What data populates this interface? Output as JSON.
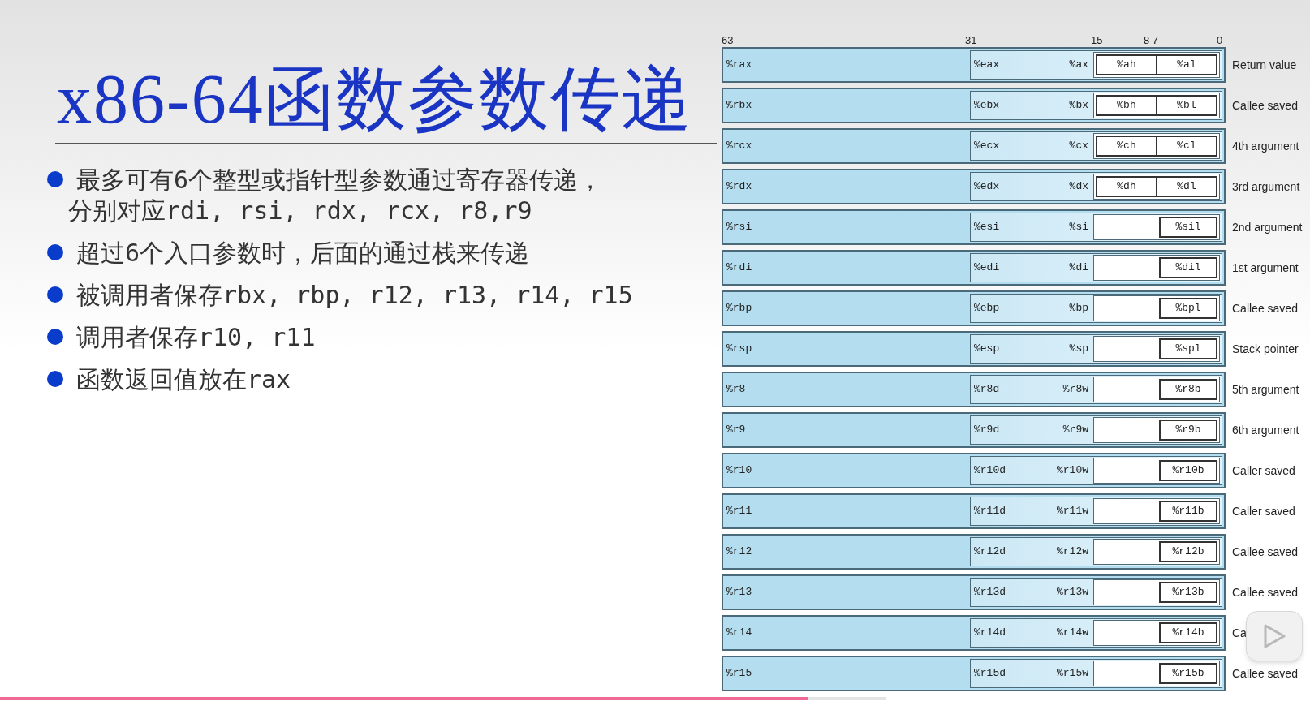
{
  "slide": {
    "title": "x86-64函数参数传递",
    "bullets": [
      {
        "lines": [
          "最多可有6个整型或指针型参数通过寄存器传递，",
          "分别对应rdi, rsi, rdx, rcx, r8,r9"
        ]
      },
      {
        "lines": [
          "超过6个入口参数时，后面的通过栈来传递"
        ]
      },
      {
        "lines": [
          "被调用者保存rbx, rbp, r12, r13, r14, r15"
        ]
      },
      {
        "lines": [
          "调用者保存r10, r11"
        ]
      },
      {
        "lines": [
          "函数返回值放在rax"
        ]
      }
    ],
    "bit_labels": [
      "63",
      "31",
      "15",
      "8 7",
      "0"
    ],
    "registers": [
      {
        "r64": "%rax",
        "r32": "%eax",
        "r16": "%ax",
        "r8h": "%ah",
        "r8l": "%al",
        "role": "Return value"
      },
      {
        "r64": "%rbx",
        "r32": "%ebx",
        "r16": "%bx",
        "r8h": "%bh",
        "r8l": "%bl",
        "role": "Callee saved"
      },
      {
        "r64": "%rcx",
        "r32": "%ecx",
        "r16": "%cx",
        "r8h": "%ch",
        "r8l": "%cl",
        "role": "4th argument"
      },
      {
        "r64": "%rdx",
        "r32": "%edx",
        "r16": "%dx",
        "r8h": "%dh",
        "r8l": "%dl",
        "role": "3rd argument"
      },
      {
        "r64": "%rsi",
        "r32": "%esi",
        "r16": "%si",
        "r8l": "%sil",
        "role": "2nd argument"
      },
      {
        "r64": "%rdi",
        "r32": "%edi",
        "r16": "%di",
        "r8l": "%dil",
        "role": "1st argument"
      },
      {
        "r64": "%rbp",
        "r32": "%ebp",
        "r16": "%bp",
        "r8l": "%bpl",
        "role": "Callee saved"
      },
      {
        "r64": "%rsp",
        "r32": "%esp",
        "r16": "%sp",
        "r8l": "%spl",
        "role": "Stack pointer"
      },
      {
        "r64": "%r8",
        "r32": "%r8d",
        "r16": "%r8w",
        "r8l": "%r8b",
        "role": "5th argument"
      },
      {
        "r64": "%r9",
        "r32": "%r9d",
        "r16": "%r9w",
        "r8l": "%r9b",
        "role": "6th argument"
      },
      {
        "r64": "%r10",
        "r32": "%r10d",
        "r16": "%r10w",
        "r8l": "%r10b",
        "role": "Caller saved"
      },
      {
        "r64": "%r11",
        "r32": "%r11d",
        "r16": "%r11w",
        "r8l": "%r11b",
        "role": "Caller saved"
      },
      {
        "r64": "%r12",
        "r32": "%r12d",
        "r16": "%r12w",
        "r8l": "%r12b",
        "role": "Callee saved"
      },
      {
        "r64": "%r13",
        "r32": "%r13d",
        "r16": "%r13w",
        "r8l": "%r13b",
        "role": "Callee saved"
      },
      {
        "r64": "%r14",
        "r32": "%r14d",
        "r16": "%r14w",
        "r8l": "%r14b",
        "role": "Ca"
      },
      {
        "r64": "%r15",
        "r32": "%r15d",
        "r16": "%r15w",
        "r8l": "%r15b",
        "role": "Callee saved"
      }
    ]
  },
  "player": {
    "progress": {
      "level": 0.617
    },
    "buffered": {
      "level": 0.676
    }
  }
}
